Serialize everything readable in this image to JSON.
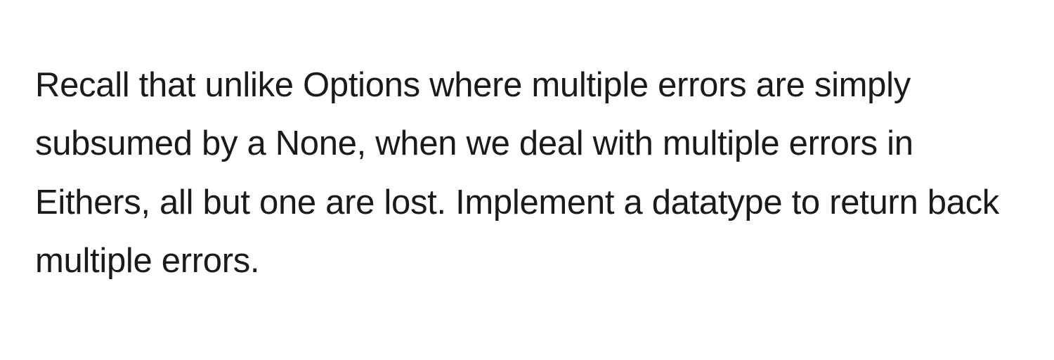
{
  "paragraph": "Recall that unlike Options where multiple errors are simply subsumed by a None, when we deal with multiple errors in Eithers, all but one are lost. Implement a datatype to return back multiple errors."
}
